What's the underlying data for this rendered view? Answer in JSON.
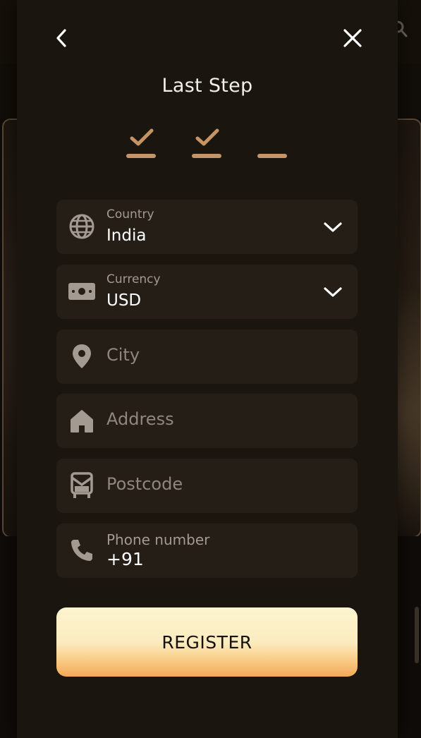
{
  "modal": {
    "title": "Last Step",
    "steps": [
      {
        "status": "done"
      },
      {
        "status": "done"
      },
      {
        "status": "current"
      }
    ]
  },
  "form": {
    "country": {
      "label": "Country",
      "value": "India",
      "icon": "globe-icon"
    },
    "currency": {
      "label": "Currency",
      "value": "USD",
      "icon": "banknote-icon"
    },
    "city": {
      "placeholder": "City",
      "icon": "location-pin-icon"
    },
    "address": {
      "placeholder": "Address",
      "icon": "home-icon"
    },
    "postcode": {
      "placeholder": "Postcode",
      "icon": "mailbox-icon"
    },
    "phone": {
      "label": "Phone number",
      "value": "+91",
      "icon": "phone-icon"
    }
  },
  "actions": {
    "register_label": "REGISTER"
  },
  "colors": {
    "accent": "#c69464",
    "field_bg": "#241e17",
    "modal_bg": "#1a150f",
    "button_top": "#fdf4cf",
    "button_bottom": "#f5a955"
  }
}
